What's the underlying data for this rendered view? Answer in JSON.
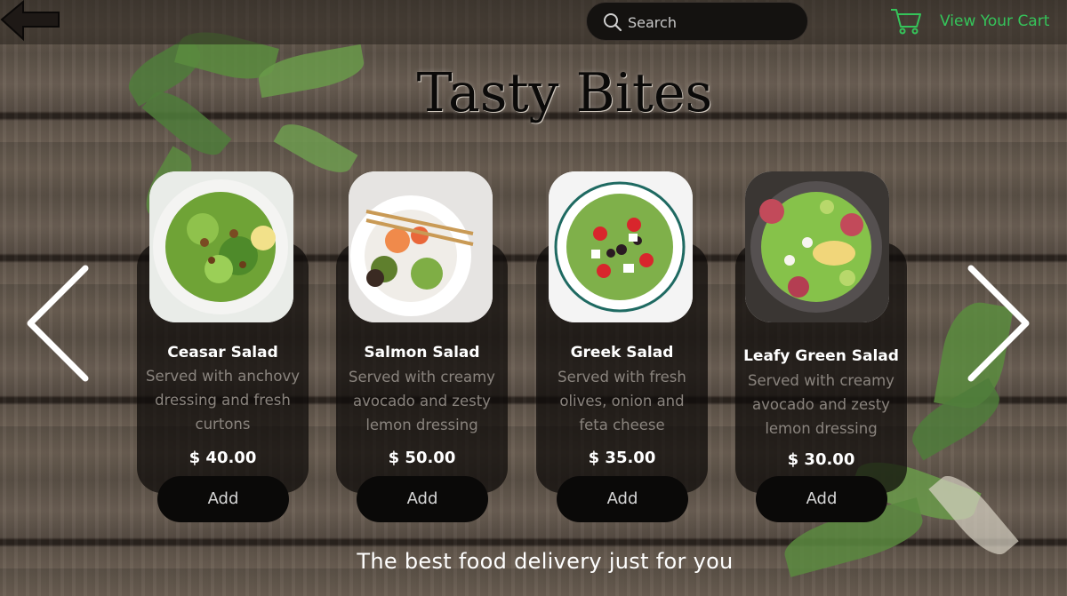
{
  "header": {
    "search_placeholder": "Search",
    "cart_label": "View Your Cart"
  },
  "title": "Tasty Bites",
  "products": [
    {
      "name": "Ceasar Salad",
      "desc_lines": [
        "Served with anchovy",
        "dressing and fresh",
        "curtons"
      ],
      "price": "$ 40.00",
      "add_label": "Add"
    },
    {
      "name": "Salmon Salad",
      "desc_lines": [
        "Served with creamy",
        "avocado and zesty",
        "lemon dressing"
      ],
      "price": "$ 50.00",
      "add_label": "Add"
    },
    {
      "name": "Greek Salad",
      "desc_lines": [
        "Served with fresh",
        "olives, onion and",
        "feta cheese"
      ],
      "price": "$ 35.00",
      "add_label": "Add"
    },
    {
      "name": "Leafy Green Salad",
      "desc_lines": [
        "Served with creamy",
        "avocado and zesty",
        "lemon dressing"
      ],
      "price": "$ 30.00",
      "add_label": "Add"
    }
  ],
  "tagline": "The best food delivery just for you",
  "colors": {
    "accent": "#35c45a",
    "text": "#ffffff",
    "muted": "#8a847e"
  }
}
